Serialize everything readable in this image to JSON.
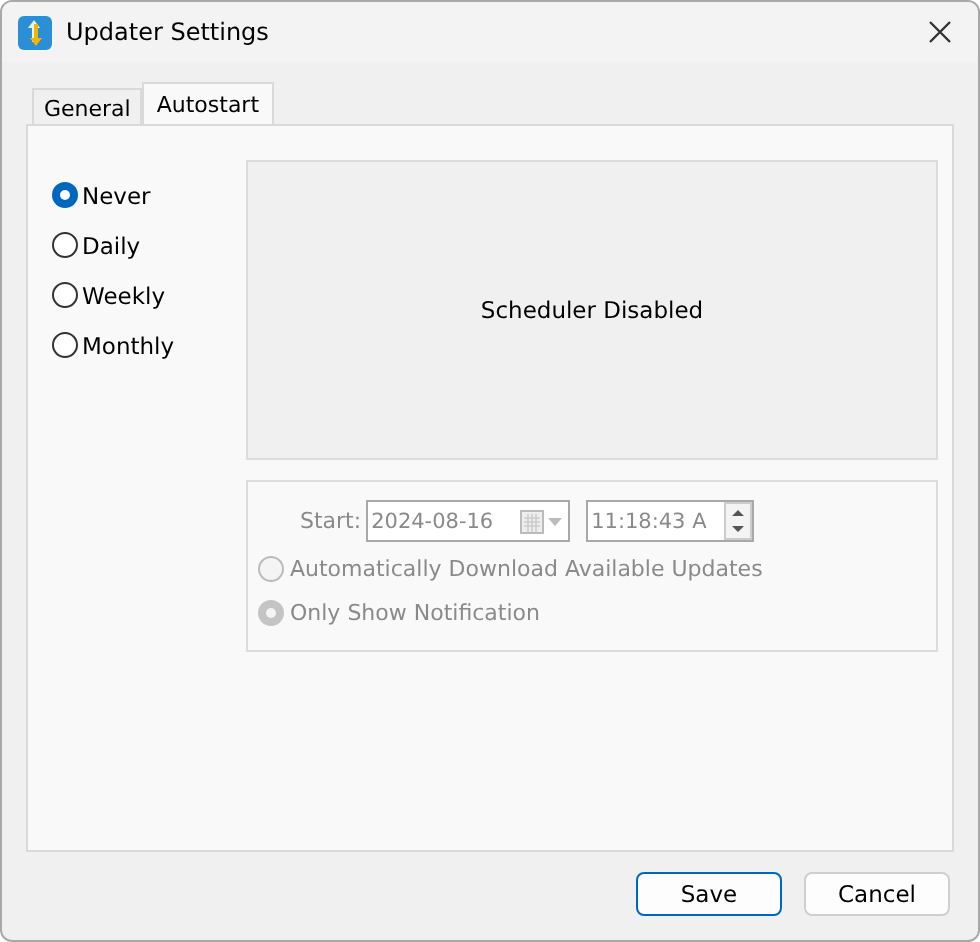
{
  "window": {
    "title": "Updater Settings"
  },
  "tabs": [
    {
      "label": "General",
      "selected": false
    },
    {
      "label": "Autostart",
      "selected": true
    }
  ],
  "schedule_options": [
    {
      "label": "Never",
      "selected": true
    },
    {
      "label": "Daily",
      "selected": false
    },
    {
      "label": "Weekly",
      "selected": false
    },
    {
      "label": "Monthly",
      "selected": false
    }
  ],
  "preview": {
    "text": "Scheduler Disabled"
  },
  "start": {
    "label": "Start:",
    "date": "2024-08-16",
    "time": "11:18:43 A",
    "disabled": true
  },
  "actions": [
    {
      "label": "Automatically Download Available Updates",
      "selected": false,
      "disabled": true
    },
    {
      "label": "Only Show Notification",
      "selected": true,
      "disabled": true
    }
  ],
  "buttons": [
    {
      "label": "Save",
      "default": true
    },
    {
      "label": "Cancel",
      "default": false
    }
  ]
}
